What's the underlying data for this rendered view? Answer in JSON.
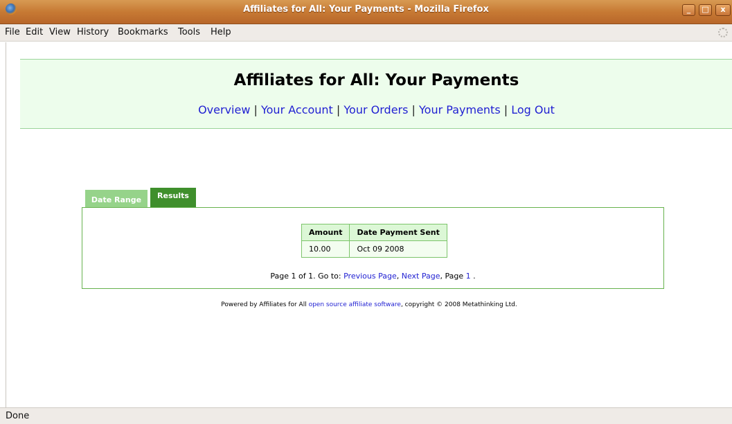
{
  "window": {
    "title": "Affiliates for All: Your Payments - Mozilla Firefox",
    "minimize_label": "_",
    "maximize_label": "□",
    "close_label": "x"
  },
  "menu": {
    "items": [
      "File",
      "Edit",
      "View",
      "History",
      "Bookmarks",
      "Tools",
      "Help"
    ]
  },
  "header": {
    "title": "Affiliates for All: Your Payments",
    "nav": [
      {
        "label": "Overview"
      },
      {
        "label": "Your Account"
      },
      {
        "label": "Your Orders"
      },
      {
        "label": "Your Payments"
      },
      {
        "label": "Log Out"
      }
    ],
    "separator": "|"
  },
  "tabs": {
    "date_range": "Date Range",
    "results": "Results"
  },
  "table": {
    "headers": [
      "Amount",
      "Date Payment Sent"
    ],
    "rows": [
      {
        "amount": "10.00",
        "date": "Oct 09 2008"
      }
    ]
  },
  "pager": {
    "prefix": "Page 1 of 1. Go to: ",
    "previous": "Previous Page",
    "comma1": ", ",
    "next": "Next Page",
    "mid": ", Page ",
    "page_link": "1",
    "suffix": " ."
  },
  "footer": {
    "prefix": "Powered by Affiliates for All ",
    "link": "open source affiliate software",
    "suffix": ", copyright © 2008 Metathinking Ltd."
  },
  "status": {
    "text": "Done"
  },
  "colors": {
    "header_bg": "#edfdec",
    "tab_active": "#3f8f2c",
    "tab_inactive": "#96d38a",
    "link": "#1f1fd2"
  }
}
